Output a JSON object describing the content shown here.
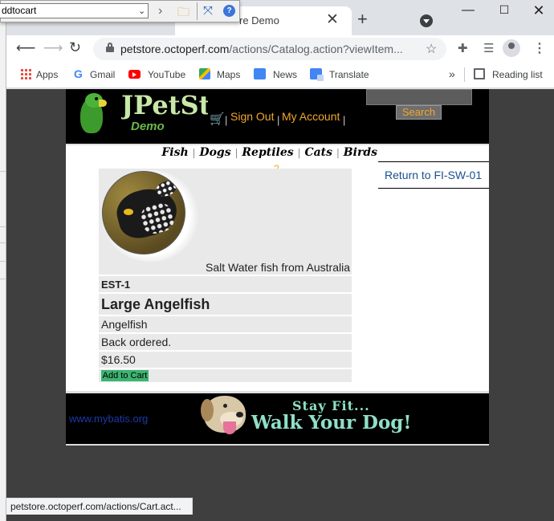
{
  "browser": {
    "tab_title": "re Demo",
    "url_host": "petstore.octoperf.com",
    "url_path": "/actions/Catalog.action?viewItem...",
    "status_url": "petstore.octoperf.com/actions/Cart.act..."
  },
  "overlay_toolbar": {
    "input_value": "ddtocart"
  },
  "bookmarks": [
    {
      "label": "Apps",
      "icon": "apps-grid-icon"
    },
    {
      "label": "Gmail",
      "icon": "gmail-icon"
    },
    {
      "label": "YouTube",
      "icon": "youtube-icon"
    },
    {
      "label": "Maps",
      "icon": "maps-icon"
    },
    {
      "label": "News",
      "icon": "news-icon"
    },
    {
      "label": "Translate",
      "icon": "translate-icon"
    }
  ],
  "reading_list": "Reading list",
  "header": {
    "logo_text": "JPetStore",
    "logo_sub": "Demo",
    "sign_out": "Sign Out",
    "my_account": "My Account",
    "search_button": "Search",
    "separator": "|"
  },
  "categories": [
    "Fish",
    "Dogs",
    "Reptiles",
    "Cats",
    "Birds"
  ],
  "help_mark": "?",
  "return_link": "Return to FI-SW-01",
  "item": {
    "caption": "Salt Water fish from Australia",
    "id": "EST-1",
    "name": "Large Angelfish",
    "product": "Angelfish",
    "status": "Back ordered.",
    "price": "$16.50",
    "add_to_cart": "Add to Cart"
  },
  "footer": {
    "link": "www.mybatis.org",
    "banner_line1": "Stay Fit...",
    "banner_line2": "Walk Your Dog!"
  },
  "colors": {
    "accent_orange": "#f3a62d",
    "add_cart_green": "#3cb371",
    "link_blue": "#1a4f8f"
  }
}
